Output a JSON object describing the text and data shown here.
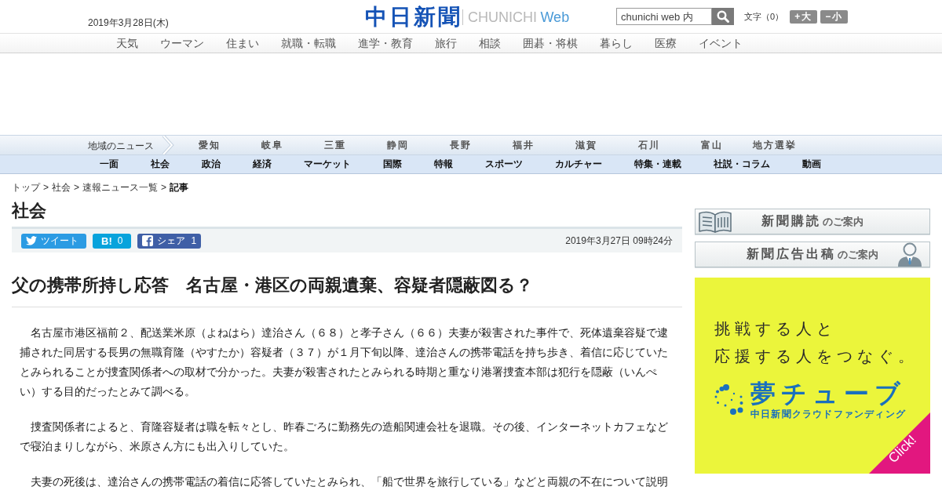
{
  "header": {
    "date": "2019年3月28日(木)",
    "logo": {
      "name": "中日新聞",
      "latin": "CHUNICHI",
      "suffix": "Web"
    },
    "search": {
      "placeholder": "chunichi web 内"
    },
    "text_size": {
      "label": "文字（0）",
      "buttons": [
        "+大",
        "−小"
      ]
    }
  },
  "service_nav": {
    "items": [
      "天気",
      "ウーマン",
      "住まい",
      "就職・転職",
      "進学・教育",
      "旅行",
      "相談",
      "囲碁・将棋",
      "暮らし",
      "医療",
      "イベント"
    ]
  },
  "region_nav": {
    "label": "地域のニュース",
    "items": [
      "愛知",
      "岐阜",
      "三重",
      "静岡",
      "長野",
      "福井",
      "滋賀",
      "石川",
      "富山",
      "地方選挙"
    ]
  },
  "category_nav": {
    "items": [
      "一面",
      "社会",
      "政治",
      "経済",
      "マーケット",
      "国際",
      "特報",
      "スポーツ",
      "カルチャー",
      "特集・連載",
      "社説・コラム",
      "動画"
    ]
  },
  "article": {
    "breadcrumb": {
      "separator": ">",
      "items": [
        {
          "label": "トップ",
          "current": false
        },
        {
          "label": "社会",
          "current": false
        },
        {
          "label": "速報ニュース一覧",
          "current": false
        },
        {
          "label": "記事",
          "current": true
        }
      ]
    },
    "section_title": "社会",
    "share_buttons": [
      {
        "kind": "tweet",
        "label": "ツイート"
      },
      {
        "kind": "hatena",
        "label": "B!",
        "count": "0"
      },
      {
        "kind": "facebook",
        "label": "シェア",
        "count": "1"
      }
    ],
    "published": "2019年3月27日 09時24分",
    "headline": "父の携帯所持し応答　名古屋・港区の両親遺棄、容疑者隠蔽図る？",
    "paragraphs": [
      "名古屋市港区福前２、配送業米原（よねはら）達治さん（６８）と孝子さん（６６）夫妻が殺害された事件で、死体遺棄容疑で逮捕された同居する長男の無職育隆（やすたか）容疑者（３７）が１月下旬以降、達治さんの携帯電話を持ち歩き、着信に応じていたとみられることが捜査関係者への取材で分かった。夫妻が殺害されたとみられる時期と重なり港署捜査本部は犯行を隠蔽（いんぺい）する目的だったとみて調べる。",
      "捜査関係者によると、育隆容疑者は職を転々とし、昨春ごろに勤務先の造船関連会社を退職。その後、インターネットカフェなどで寝泊まりしながら、米原さん方にも出入りしていた。",
      "夫妻の死後は、達治さんの携帯電話の着信に応答していたとみられ、「船で世界を旅行している」などと両親の不在について説明"
    ]
  },
  "sidebar": {
    "banners": [
      {
        "kind": "book",
        "title": "新聞購読",
        "suffix": "のご案内"
      },
      {
        "kind": "person",
        "title": "新聞広告出稿",
        "suffix": "のご案内"
      }
    ],
    "ad": {
      "tagline": [
        "挑戦する人と",
        "応援する人をつなぐ。"
      ],
      "brand": "夢チューブ",
      "subtitle": "中日新聞クラウドファンディング",
      "corner": "Click!"
    }
  }
}
